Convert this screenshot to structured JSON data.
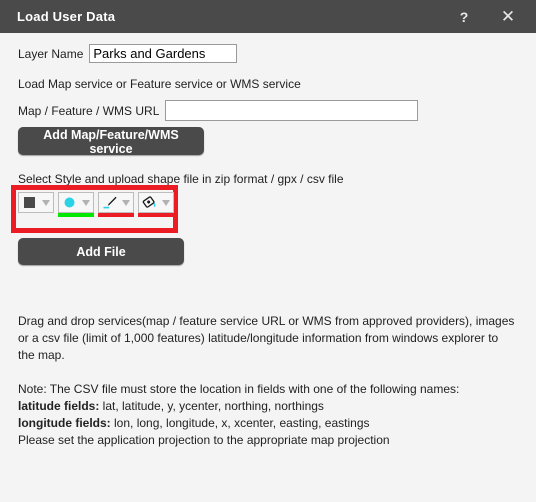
{
  "titlebar": {
    "title": "Load User Data",
    "help_label": "?",
    "close_label": "✕"
  },
  "form": {
    "layer_name_label": "Layer Name",
    "layer_name_value": "Parks and Gardens",
    "layer_name_placeholder": "",
    "service_hint": "Load Map service or Feature service or WMS service",
    "url_label": "Map / Feature / WMS URL",
    "url_value": "",
    "url_placeholder": "",
    "add_service_label": "Add Map/Feature/WMS service",
    "style_hint": "Select Style and upload shape file in zip format / gpx / csv file",
    "add_file_label": "Add File"
  },
  "style_tools": [
    {
      "name": "fill-square-tool",
      "icon": "square-icon",
      "color": "#4a4a4a",
      "underline": ""
    },
    {
      "name": "point-marker-tool",
      "icon": "circle-icon",
      "color": "#2ad2e6",
      "underline": "#00e800"
    },
    {
      "name": "line-pen-tool",
      "icon": "pen-icon",
      "color": "#111111",
      "underline": "#ec1c24"
    },
    {
      "name": "fill-bucket-tool",
      "icon": "paint-bucket-icon",
      "color": "#111111",
      "underline": "#ec1c24"
    }
  ],
  "info": {
    "drag_text": "Drag and drop services(map / feature service URL or WMS from approved providers), images or a csv file (limit of 1,000 features) latitude/longitude information from windows explorer to the map.",
    "note_intro": "Note: The CSV file must store the location in fields with one of the following names:",
    "latitude_label": "latitude fields:",
    "latitude_values": " lat, latitude, y, ycenter, northing, northings",
    "longitude_label": "longitude fields:",
    "longitude_values": " lon, long, longitude, x, xcenter, easting, eastings",
    "projection_note": "Please set the application projection to the appropriate map projection"
  },
  "colors": {
    "highlight": "#ec1c24",
    "titlebar": "#4a4a4a",
    "accent_cyan": "#2ad2e6",
    "underline_green": "#00e800"
  }
}
